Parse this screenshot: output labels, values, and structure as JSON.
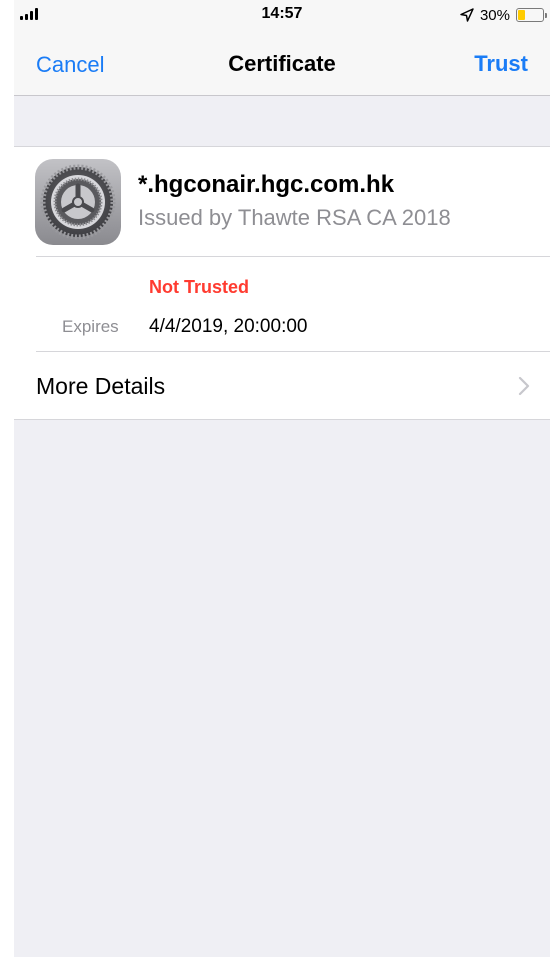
{
  "status_bar": {
    "time": "14:57",
    "battery_percent": "30%",
    "battery_level": 0.3,
    "battery_color": "#ffcc00",
    "icons": [
      "signal-icon",
      "location-arrow-icon",
      "battery-icon"
    ]
  },
  "nav": {
    "cancel_label": "Cancel",
    "title": "Certificate",
    "trust_label": "Trust",
    "accent_color": "#1a7cf6"
  },
  "certificate": {
    "icon": "settings-gear-icon",
    "name": "*.hgconair.hgc.com.hk",
    "issuer": "Issued by Thawte RSA CA 2018",
    "status": "Not Trusted",
    "status_color": "#ff3b30",
    "expires_label": "Expires",
    "expires_value": "4/4/2019, 20:00:00"
  },
  "more_details": {
    "label": "More Details",
    "icon": "chevron-right-icon"
  }
}
